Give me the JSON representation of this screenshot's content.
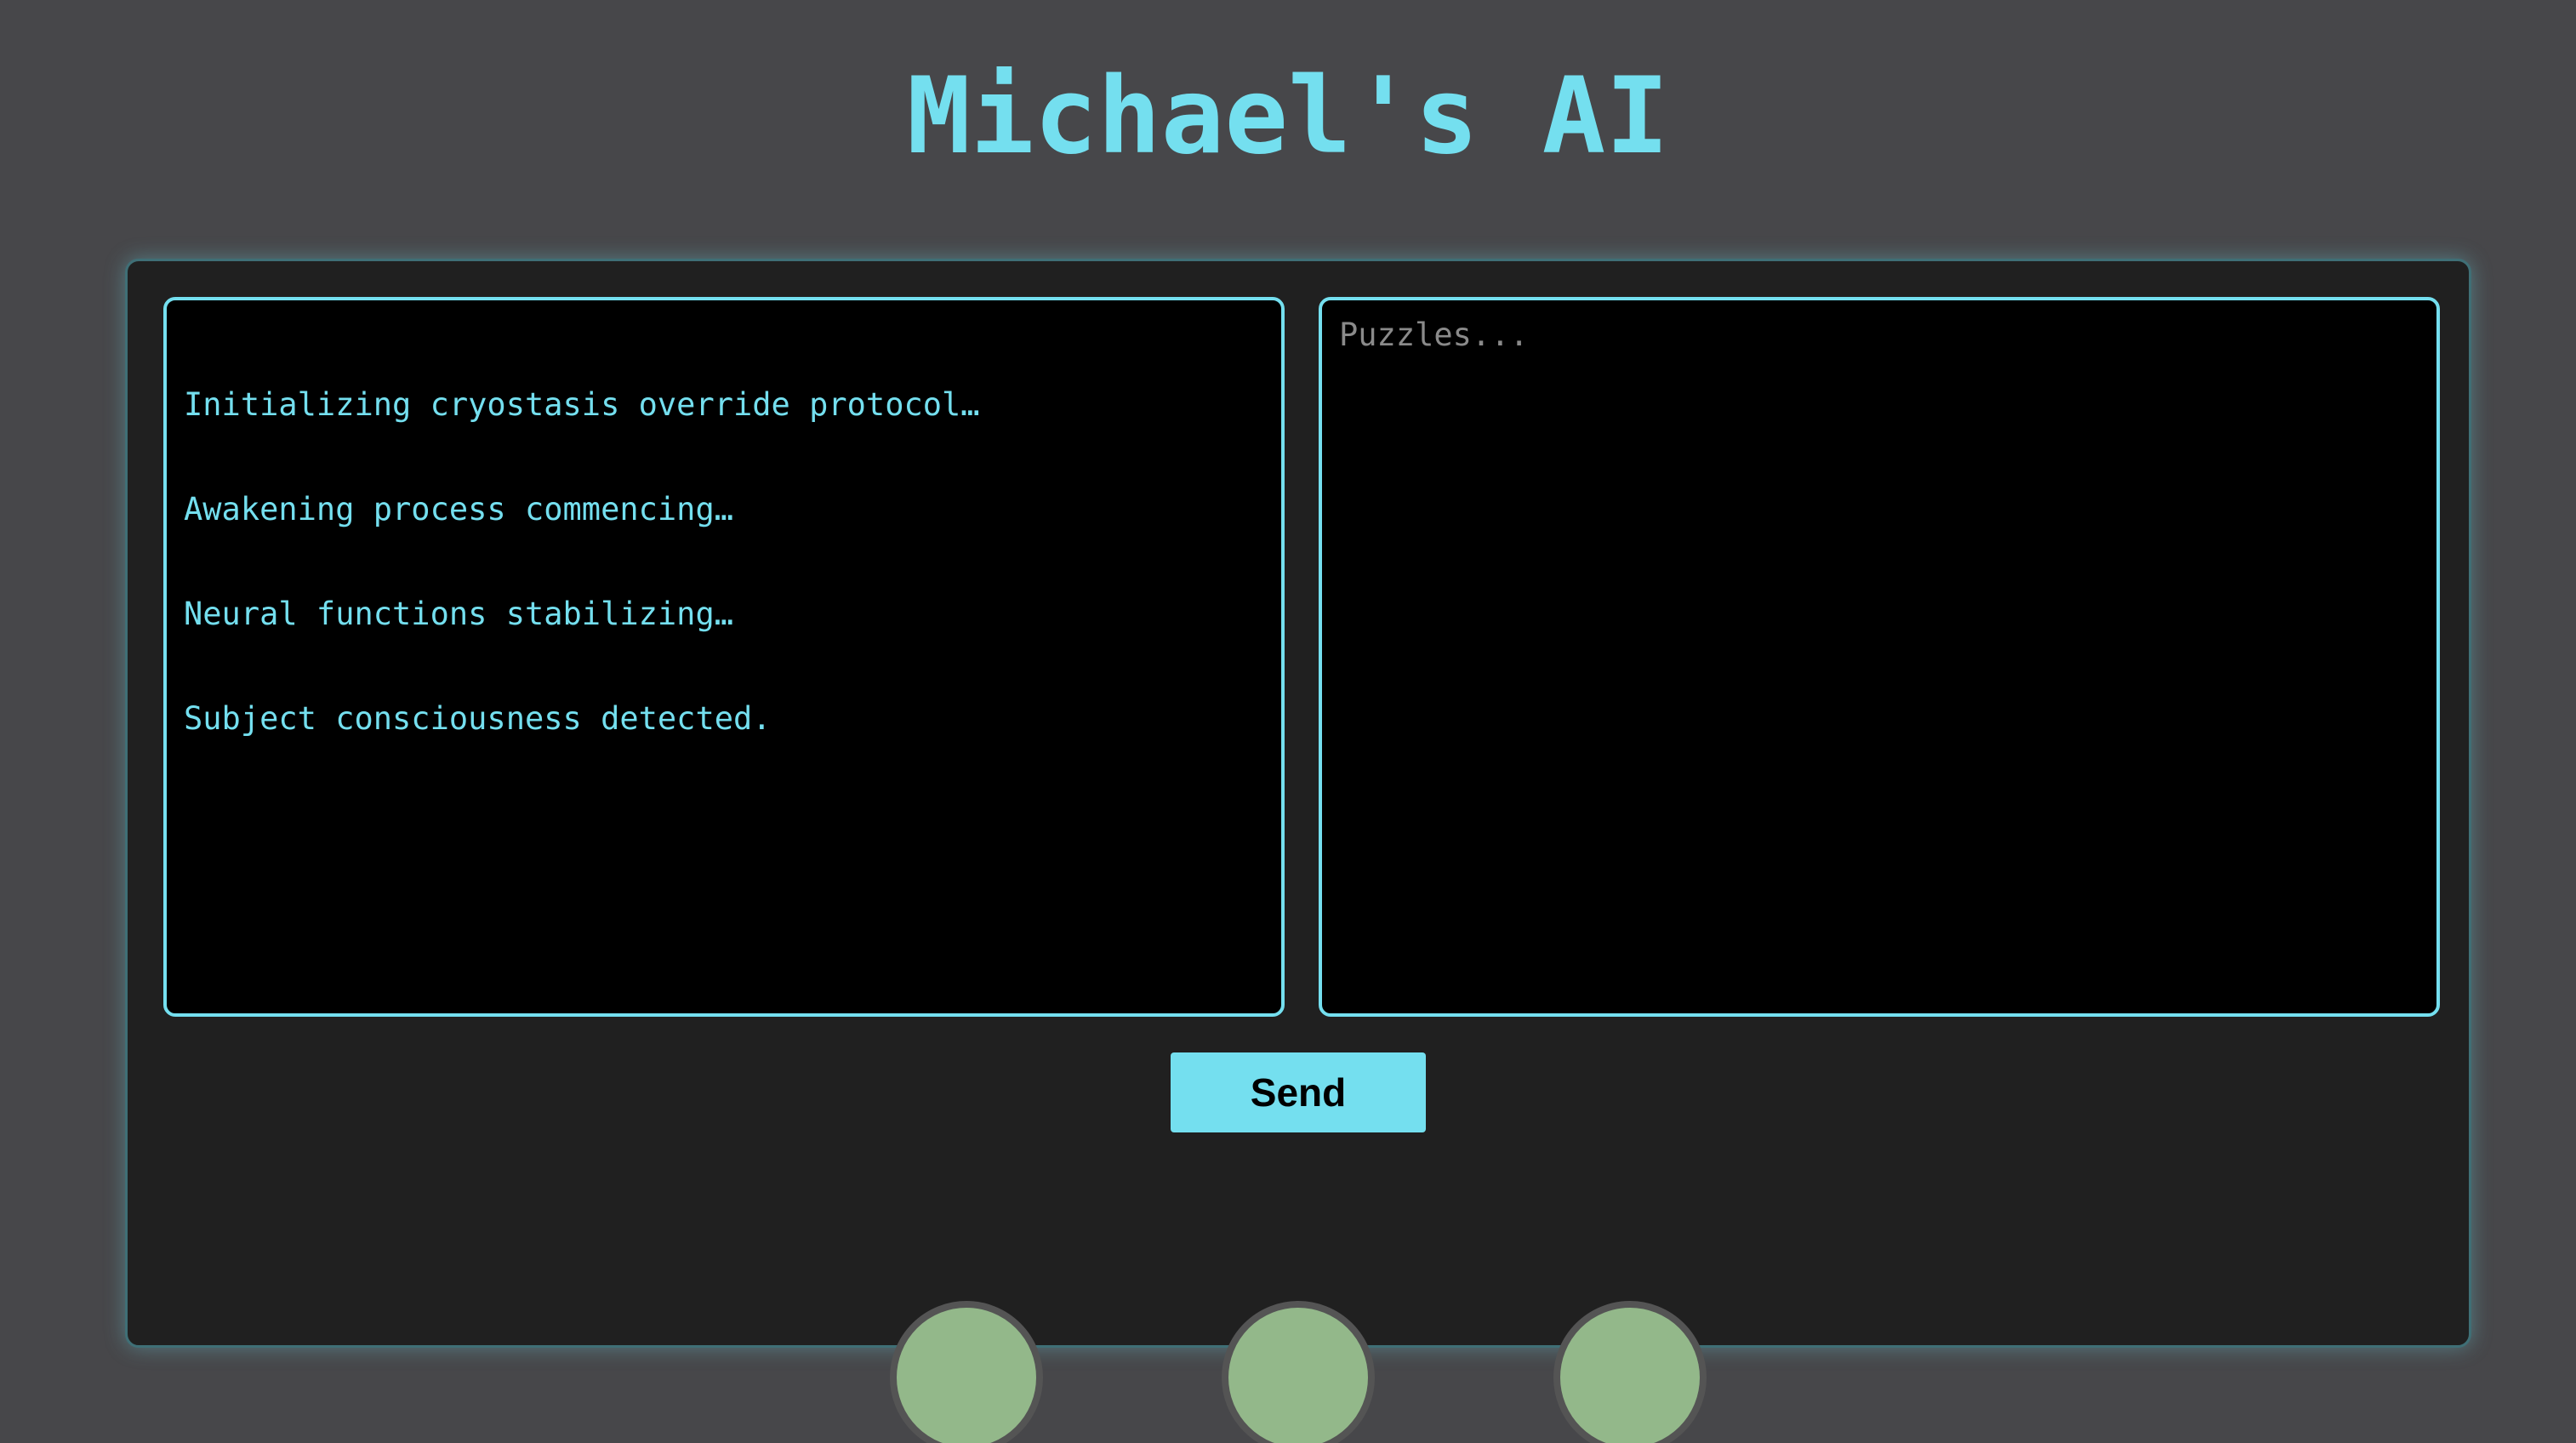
{
  "app": {
    "title": "Michael's AI"
  },
  "output_console": {
    "lines": [
      "Initializing cryostasis override protocol…",
      "Awakening process commencing…",
      "Neural functions stabilizing…",
      "Subject consciousness detected."
    ]
  },
  "input_console": {
    "value": "",
    "placeholder": "Puzzles..."
  },
  "controls": {
    "send_label": "Send"
  },
  "indicators": [
    {
      "name": "indicator-1",
      "color": "#93b88a"
    },
    {
      "name": "indicator-2",
      "color": "#93b88a"
    },
    {
      "name": "indicator-3",
      "color": "#93b88a"
    }
  ],
  "colors": {
    "accent": "#74dfef",
    "page_background": "#47474a",
    "panel_background": "#202020",
    "screen_background": "#000000",
    "indicator_fill": "#93b88a",
    "indicator_border": "#545454"
  }
}
